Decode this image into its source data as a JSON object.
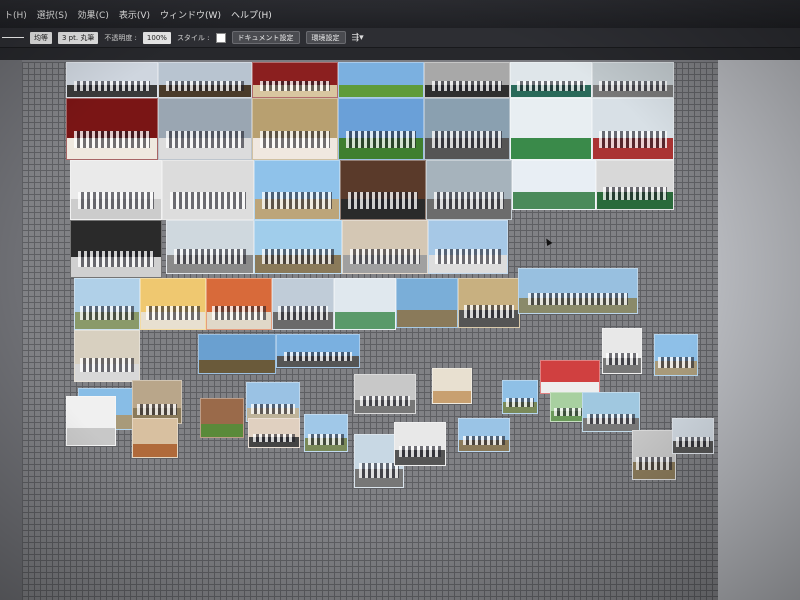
{
  "menu": {
    "items": [
      "ト(H)",
      "選択(S)",
      "効果(C)",
      "表示(V)",
      "ウィンドウ(W)",
      "ヘルプ(H)"
    ]
  },
  "control_bar": {
    "stroke_style": "均等",
    "stroke_width": "3 pt. 丸筆",
    "opacity_label": "不透明度 :",
    "opacity_value": "100%",
    "style_label": "スタイル :",
    "document_setup_button": "ドキュメント設定",
    "preferences_button": "環境設定"
  },
  "photos": [
    {
      "id": "p1",
      "sky": "#cfd6df",
      "ground": "#3a3a3a",
      "people": true
    },
    {
      "id": "p2",
      "sky": "#b8c4d0",
      "ground": "#4a3b2a",
      "people": true
    },
    {
      "id": "p3",
      "sky": "#8b1f1f",
      "ground": "#d9c6a0",
      "people": true
    },
    {
      "id": "p4",
      "sky": "#7bb0e0",
      "ground": "#5f9b3a",
      "people": false
    },
    {
      "id": "p5",
      "sky": "#a8a8a8",
      "ground": "#2f2f2f",
      "people": true
    },
    {
      "id": "p6",
      "sky": "#dfe6ea",
      "ground": "#2a6a5a",
      "people": true
    },
    {
      "id": "p7",
      "sky": "#c0c8cc",
      "ground": "#777",
      "people": true
    },
    {
      "id": "p8",
      "sky": "#7a1515",
      "ground": "#efe9e0",
      "people": true
    },
    {
      "id": "p9",
      "sky": "#9aa6b2",
      "ground": "#dcdcdc",
      "people": true
    },
    {
      "id": "p10",
      "sky": "#b8a070",
      "ground": "#f0e8e0",
      "people": true
    },
    {
      "id": "p11",
      "sky": "#6aa0d8",
      "ground": "#3f7f2f",
      "people": true
    },
    {
      "id": "p12",
      "sky": "#8aa0b0",
      "ground": "#555",
      "people": true
    },
    {
      "id": "p13",
      "sky": "#e8eef2",
      "ground": "#3a8a4a",
      "people": false
    },
    {
      "id": "p14",
      "sky": "#d8e0e6",
      "ground": "#a33",
      "people": true
    },
    {
      "id": "p15",
      "sky": "#eaeaea",
      "ground": "#ccc",
      "people": true
    },
    {
      "id": "p16",
      "sky": "#dcdcdc",
      "ground": "#ddd",
      "people": true
    },
    {
      "id": "p17",
      "sky": "#8fc2ea",
      "ground": "#bca57a",
      "people": true
    },
    {
      "id": "p18",
      "sky": "#5a3a2a",
      "ground": "#2a2a2a",
      "people": true
    },
    {
      "id": "p19",
      "sky": "#a6b3bc",
      "ground": "#6c6c6c",
      "people": true
    },
    {
      "id": "p20",
      "sky": "#e8eef4",
      "ground": "#4a8a5a",
      "people": false
    },
    {
      "id": "p21",
      "sky": "#d8d8d8",
      "ground": "#2a6a3a",
      "people": true
    },
    {
      "id": "p22",
      "sky": "#2a2a2a",
      "ground": "#d0d0d0",
      "people": true
    },
    {
      "id": "p23",
      "sky": "#cfd8de",
      "ground": "#8a8a8a",
      "people": true
    },
    {
      "id": "p24",
      "sky": "#a0cdeb",
      "ground": "#8a7a5a",
      "people": true
    },
    {
      "id": "p25",
      "sky": "#d4c7b4",
      "ground": "#a0a0a0",
      "people": true
    },
    {
      "id": "p26",
      "sky": "#a6c8e6",
      "ground": "#ddd",
      "people": true
    },
    {
      "id": "p27",
      "sky": "#b0d0e8",
      "ground": "#8a9a6a",
      "people": true
    },
    {
      "id": "p28",
      "sky": "#efc870",
      "ground": "#e8e0d0",
      "people": true
    },
    {
      "id": "p29",
      "sky": "#d86a3a",
      "ground": "#e0d8c8",
      "people": true
    },
    {
      "id": "p30",
      "sky": "#c0ccd8",
      "ground": "#6a6a6a",
      "people": true
    },
    {
      "id": "p31",
      "sky": "#e0e8ee",
      "ground": "#5a9a6a",
      "people": false
    },
    {
      "id": "p32",
      "sky": "#7aaed8",
      "ground": "#8a7a5a",
      "people": false
    },
    {
      "id": "p33",
      "sky": "#c8b080",
      "ground": "#555",
      "people": true
    },
    {
      "id": "p34",
      "sky": "#98c0e0",
      "ground": "#8a8a6a",
      "people": true
    },
    {
      "id": "p35",
      "sky": "#d8d0c0",
      "ground": "#d8d8d8",
      "people": true
    },
    {
      "id": "p36",
      "sky": "#6aa0d0",
      "ground": "#6a5a3a",
      "people": false
    },
    {
      "id": "p37",
      "sky": "#7ab0e0",
      "ground": "#555",
      "people": true
    },
    {
      "id": "p38",
      "sky": "#88bde6",
      "ground": "#a89a7a",
      "people": false
    },
    {
      "id": "p39",
      "sky": "#b9a68a",
      "ground": "#8a7a5a",
      "people": true
    },
    {
      "id": "p40",
      "sky": "#9ac2e4",
      "ground": "#bfb49a",
      "people": true
    },
    {
      "id": "p41",
      "sky": "#c8c8c8",
      "ground": "#777",
      "people": true
    },
    {
      "id": "p42",
      "sky": "#e8e0d0",
      "ground": "#c8a070",
      "people": false
    },
    {
      "id": "p43",
      "sky": "#8fc0e6",
      "ground": "#7a8a5a",
      "people": true
    },
    {
      "id": "p44",
      "sky": "#d04040",
      "ground": "#eee",
      "people": false
    },
    {
      "id": "p45",
      "sky": "#e8e8e8",
      "ground": "#777",
      "people": true
    },
    {
      "id": "p46",
      "sky": "#8ec0e8",
      "ground": "#a89a7a",
      "people": true
    },
    {
      "id": "p47",
      "sky": "#f0f0f0",
      "ground": "#c8c8c8",
      "people": false
    },
    {
      "id": "p48",
      "sky": "#d8c0a0",
      "ground": "#b06a3a",
      "people": false
    },
    {
      "id": "p49",
      "sky": "#9a6a4a",
      "ground": "#5a8a3a",
      "people": false
    },
    {
      "id": "p50",
      "sky": "#e0d0c0",
      "ground": "#444",
      "people": true
    },
    {
      "id": "p51",
      "sky": "#a0c8e8",
      "ground": "#7a8a5a",
      "people": true
    },
    {
      "id": "p52",
      "sky": "#c8d8e4",
      "ground": "#777",
      "people": true
    },
    {
      "id": "p53",
      "sky": "#e8e8e8",
      "ground": "#555",
      "people": true
    },
    {
      "id": "p54",
      "sky": "#9ac4e6",
      "ground": "#8a7a5a",
      "people": true
    },
    {
      "id": "p55",
      "sky": "#a8d0a0",
      "ground": "#6a9a5a",
      "people": true
    },
    {
      "id": "p56",
      "sky": "#a0c8e0",
      "ground": "#777",
      "people": true
    },
    {
      "id": "p57",
      "sky": "#c8c8c8",
      "ground": "#8a7a5a",
      "people": true
    },
    {
      "id": "p58",
      "sky": "#d0d8e0",
      "ground": "#555",
      "people": true
    }
  ]
}
